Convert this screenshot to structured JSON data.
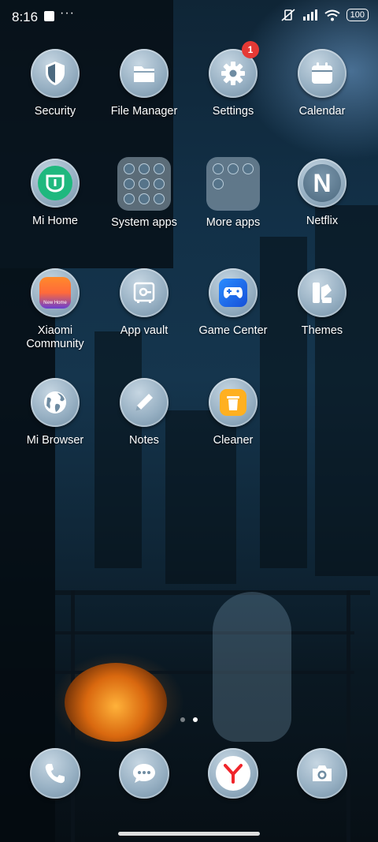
{
  "status_bar": {
    "time": "8:16",
    "battery": "100"
  },
  "apps": [
    {
      "label": "Security"
    },
    {
      "label": "File Manager"
    },
    {
      "label": "Settings",
      "badge": "1"
    },
    {
      "label": "Calendar"
    },
    {
      "label": "Mi Home"
    },
    {
      "label": "System apps"
    },
    {
      "label": "More apps"
    },
    {
      "label": "Netflix"
    },
    {
      "label": "Xiaomi Community",
      "sublabel": "New Home"
    },
    {
      "label": "App vault"
    },
    {
      "label": "Game Center"
    },
    {
      "label": "Themes"
    },
    {
      "label": "Mi Browser"
    },
    {
      "label": "Notes"
    },
    {
      "label": "Cleaner"
    }
  ],
  "page_indicator": {
    "pages": 2,
    "current": 2
  },
  "dock": [
    {
      "icon": "phone-icon"
    },
    {
      "icon": "messages-icon"
    },
    {
      "icon": "yandex-browser-icon"
    },
    {
      "icon": "camera-icon"
    }
  ]
}
